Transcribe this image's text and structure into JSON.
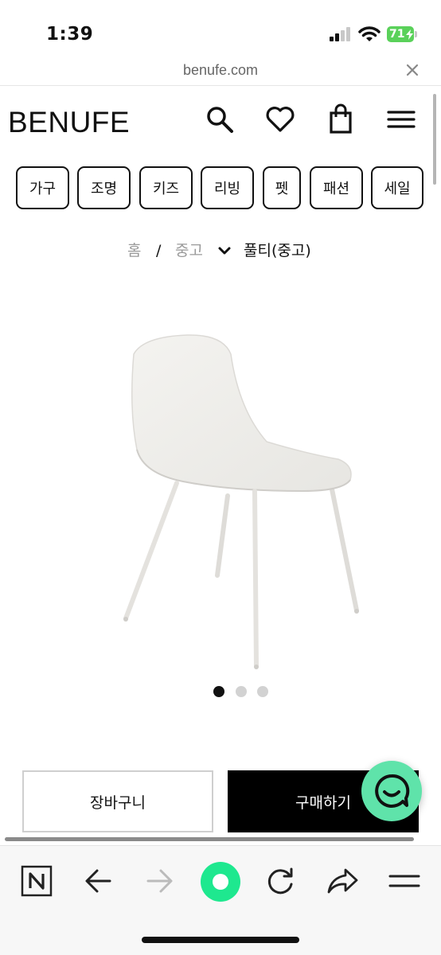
{
  "status_bar": {
    "time": "1:39",
    "battery_level": "71",
    "battery_color": "#5ad15a"
  },
  "browser": {
    "url": "benufe.com",
    "close_icon": "close-icon"
  },
  "header": {
    "logo": "BENUFE",
    "icons": [
      "search-icon",
      "heart-icon",
      "shopping-bag-icon",
      "menu-icon"
    ]
  },
  "categories": [
    "가구",
    "조명",
    "키즈",
    "리빙",
    "펫",
    "패션",
    "세일"
  ],
  "breadcrumb": {
    "home": "홈",
    "separator": "/",
    "parent": "중고",
    "current": "풀티(중고)"
  },
  "product": {
    "image_icon": "white-chair-image",
    "image_count": 3,
    "active_image": 1
  },
  "actions": {
    "cart_label": "장바구니",
    "buy_label": "구매하기",
    "chat_icon": "chat-smile-icon",
    "chat_color": "#5fe3aa"
  },
  "browser_toolbar": {
    "icons": [
      "naver-n-icon",
      "back-arrow-icon",
      "forward-arrow-icon",
      "green-dot-icon",
      "refresh-icon",
      "share-icon",
      "menu-icon"
    ],
    "accent": "#1ee88f"
  }
}
